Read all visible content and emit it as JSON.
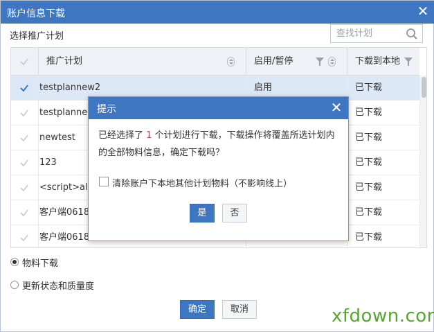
{
  "window": {
    "title": "账户信息下载"
  },
  "plan_section": {
    "label": "选择推广计划"
  },
  "search": {
    "placeholder": "查找计划"
  },
  "table": {
    "columns": [
      "推广计划",
      "启用/暂停",
      "下载到本地"
    ],
    "rows": [
      {
        "name": "testplannew2",
        "status": "启用",
        "download": "已下载",
        "selected": true
      },
      {
        "name": "testplannew",
        "status": "",
        "download": "已下载",
        "selected": false
      },
      {
        "name": "newtest",
        "status": "",
        "download": "已下载",
        "selected": false
      },
      {
        "name": "123",
        "status": "",
        "download": "已下载",
        "selected": false
      },
      {
        "name": "<script>ale",
        "status": "",
        "download": "已下载",
        "selected": false
      },
      {
        "name": "客户端0618",
        "status": "",
        "download": "已下载",
        "selected": false
      },
      {
        "name": "客户端0618",
        "status": "",
        "download": "已下载",
        "selected": false
      }
    ]
  },
  "options": {
    "material_download": "物料下载",
    "update_status": "更新状态和质量度",
    "selected": "material_download"
  },
  "footer": {
    "confirm": "确定",
    "cancel": "取消"
  },
  "dialog": {
    "title": "提示",
    "message_before": "已经选择了",
    "count": "1",
    "message_after": "个计划进行下载，下载操作将覆盖所选计划内的全部物料信息，确定下载吗？",
    "checkbox_label": "清除账户下本地其他计划物料（不影响线上）",
    "yes": "是",
    "no": "否"
  },
  "watermark": "xfdown.com",
  "colors": {
    "accent": "#3e76c2",
    "count_red": "#d9312b",
    "watermark_green": "#55a72c"
  }
}
